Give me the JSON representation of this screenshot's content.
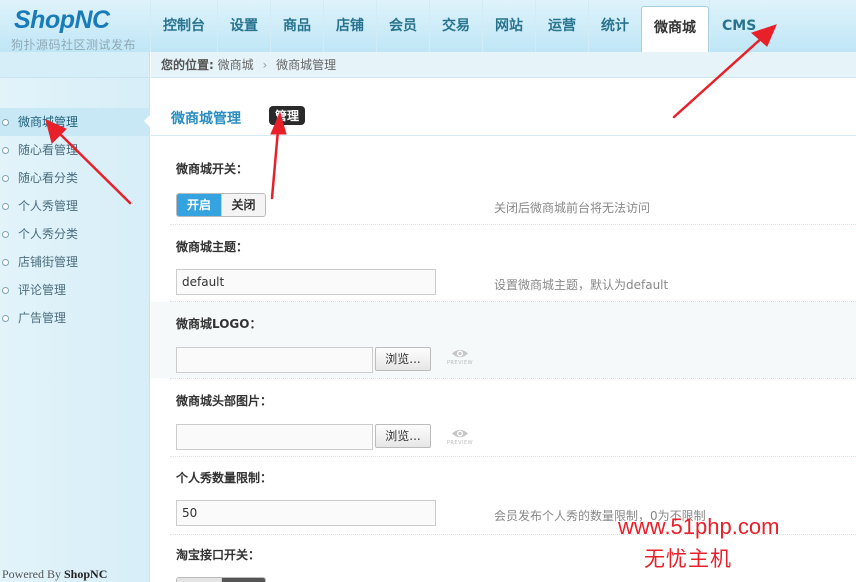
{
  "logo": {
    "text_shop": "Shop",
    "text_nc": "NC",
    "subtitle": "狗扑源码社区测试发布"
  },
  "nav": {
    "items": [
      "控制台",
      "设置",
      "商品",
      "店铺",
      "会员",
      "交易",
      "网站",
      "运营",
      "统计",
      "微商城",
      "CMS"
    ],
    "active": "微商城"
  },
  "breadcrumb": {
    "prefix": "您的位置:",
    "level1": "微商城",
    "separator": "›",
    "level2": "微商城管理"
  },
  "sidebar": {
    "items": [
      "微商城管理",
      "随心看管理",
      "随心看分类",
      "个人秀管理",
      "个人秀分类",
      "店铺街管理",
      "评论管理",
      "广告管理"
    ],
    "powered_prefix": "Powered By ",
    "powered_brand": "ShopNC"
  },
  "main": {
    "title": "微商城管理",
    "tab": "管理",
    "fields": {
      "switch": {
        "label": "微商城开关：",
        "on": "开启",
        "off": "关闭",
        "hint": "关闭后微商城前台将无法访问"
      },
      "theme": {
        "label": "微商城主题：",
        "value": "default",
        "hint": "设置微商城主题，默认为default"
      },
      "logo": {
        "label": "微商城LOGO：",
        "browse": "浏览...",
        "preview": "PREVIEW"
      },
      "header_img": {
        "label": "微商城头部图片：",
        "browse": "浏览...",
        "preview": "PREVIEW"
      },
      "show_limit": {
        "label": "个人秀数量限制：",
        "value": "50",
        "hint": "会员发布个人秀的数量限制，0为不限制"
      },
      "taobao": {
        "label": "淘宝接口开关："
      }
    }
  },
  "watermark": {
    "line1": "www.51php.com",
    "line2": "无忧主机"
  },
  "colors": {
    "accent": "#2a8ec0",
    "toggle_on": "#35a3e0",
    "arrow": "#e8202a"
  }
}
